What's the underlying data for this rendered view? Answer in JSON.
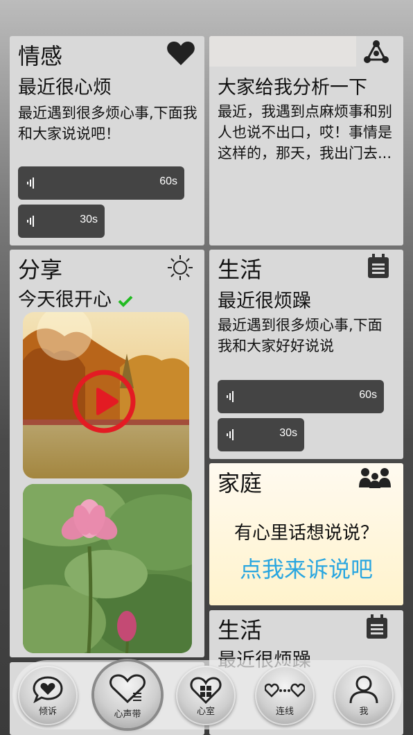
{
  "cards": {
    "emotion": {
      "category": "情感",
      "subtitle": "最近很心烦",
      "body": "最近遇到很多烦心事,下面我和大家说说吧！",
      "voice": [
        {
          "duration": "60s"
        },
        {
          "duration": "30s"
        }
      ]
    },
    "analyze": {
      "subtitle": "大家给我分析一下",
      "body": "最近，我遇到点麻烦事和别人也说不出口，哎！事情是这样的，那天，我出门去..."
    },
    "share": {
      "category": "分享",
      "subtitle": "今天很开心"
    },
    "life1": {
      "category": "生活",
      "subtitle": "最近很烦躁",
      "body": "最近遇到很多烦心事,下面我和大家好好说说",
      "voice": [
        {
          "duration": "60s"
        },
        {
          "duration": "30s"
        }
      ]
    },
    "family": {
      "category": "家庭",
      "question": "有心里话想说说？",
      "cta": "点我来诉说吧"
    },
    "life2": {
      "category": "生活",
      "subtitle": "最近很烦躁"
    }
  },
  "nav": {
    "items": [
      {
        "label": "倾诉",
        "icon": "speech-heart-icon"
      },
      {
        "label": "心声带",
        "icon": "heart-outline-icon"
      },
      {
        "label": "心室",
        "icon": "heart-grid-icon"
      },
      {
        "label": "连线",
        "icon": "hearts-link-icon"
      },
      {
        "label": "我",
        "icon": "person-icon"
      }
    ]
  },
  "colors": {
    "card": "#d9d9d9",
    "voice": "#444444",
    "cta": "#29a6e0",
    "play": "#e31b23",
    "check": "#22bb22",
    "family_bg": "#fff3cc"
  }
}
